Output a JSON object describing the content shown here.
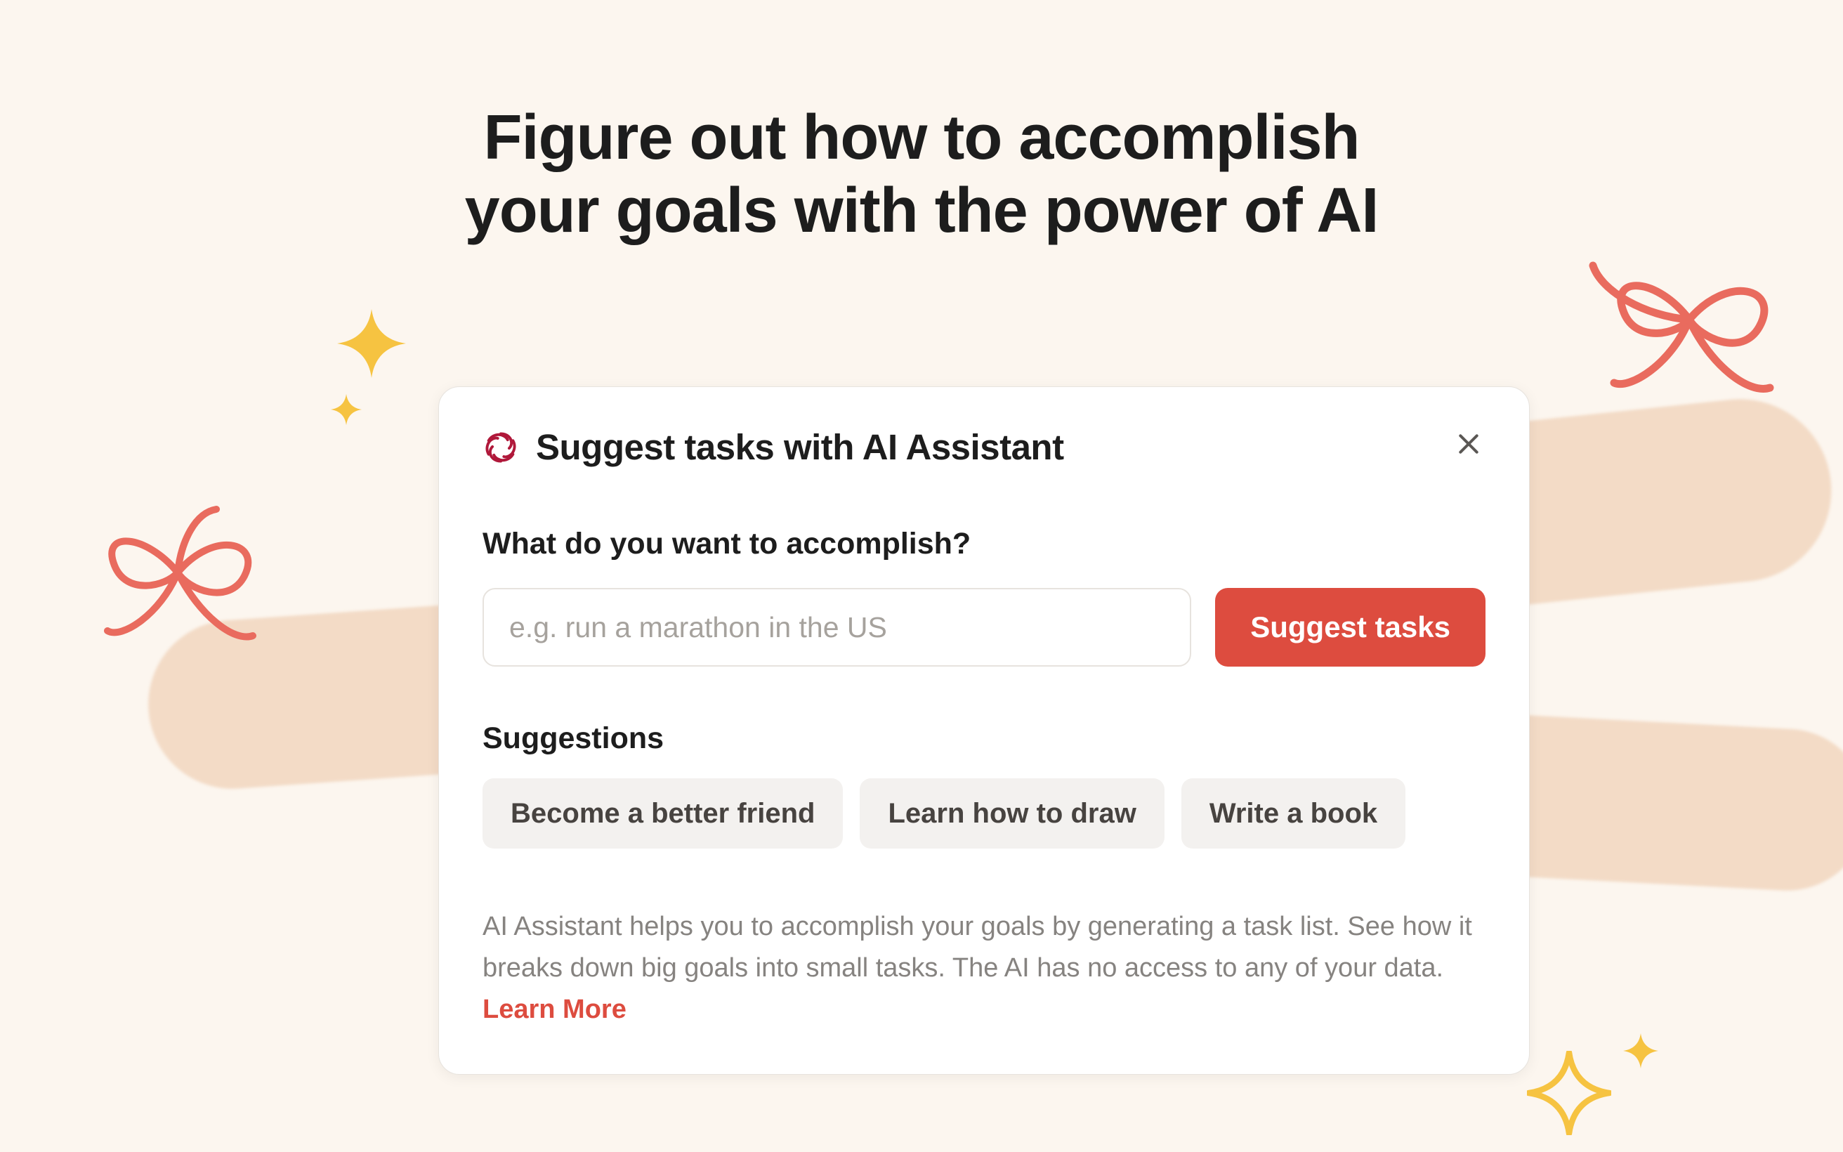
{
  "page": {
    "headline_line1": "Figure out how to accomplish",
    "headline_line2": "your goals with the power of AI"
  },
  "card": {
    "title": "Suggest tasks with AI Assistant",
    "prompt_label": "What do you want to accomplish?",
    "input_placeholder": "e.g. run a marathon in the US",
    "suggest_button_label": "Suggest tasks",
    "suggestions_label": "Suggestions",
    "suggestions": [
      "Become a better friend",
      "Learn how to draw",
      "Write a book"
    ],
    "footer_text": "AI Assistant helps you to accomplish your goals by generating a task list. See how it breaks down big goals into small tasks. The AI has no access to any of your data. ",
    "learn_more_label": "Learn More"
  },
  "icons": {
    "ai_icon": "openai-knot-icon",
    "close_icon": "close-icon",
    "sparkle_icon": "sparkle-icon",
    "bow_icon": "ribbon-bow-icon"
  },
  "colors": {
    "accent": "#dd4c3f",
    "bg": "#fcf6ef",
    "sparkle": "#f6c341",
    "bow": "#e96b5e"
  }
}
